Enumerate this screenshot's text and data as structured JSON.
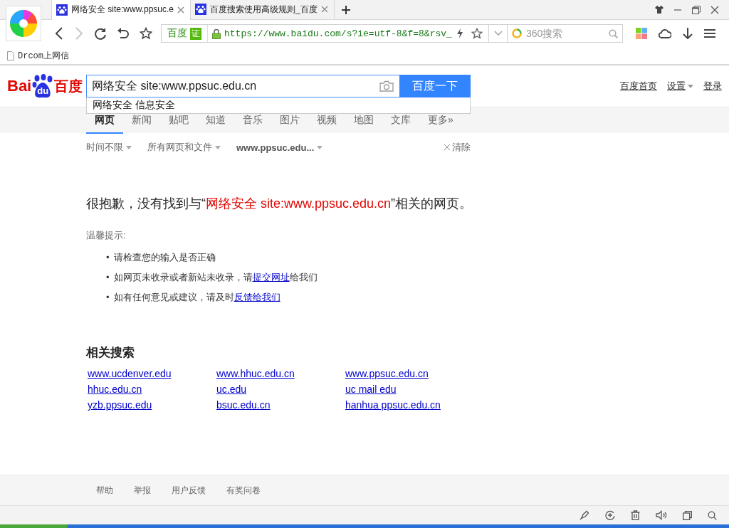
{
  "browser": {
    "tabs": [
      {
        "title": "网络安全 site:www.ppsuc.e",
        "selected": true
      },
      {
        "title": "百度搜索使用高级规则_百度",
        "selected": false
      }
    ],
    "toolbar": {
      "site_label": "百度",
      "cert_badge": "证",
      "url": "https://www.baidu.com/s?ie=utf-8&f=8&rsv_",
      "search_placeholder": "360搜索"
    },
    "bookmarks": [
      "Drcom上网信"
    ]
  },
  "page": {
    "logo": [
      "Bai",
      "du",
      "百度"
    ],
    "search_value": "网络安全 site:www.ppsuc.edu.cn",
    "search_button": "百度一下",
    "suggestion": "网络安全 信息安全",
    "top_links": [
      {
        "label": "百度首页",
        "dropdown": false
      },
      {
        "label": "设置",
        "dropdown": true
      },
      {
        "label": "登录",
        "dropdown": false
      }
    ],
    "nav_tabs": [
      {
        "label": "网页",
        "selected": true
      },
      {
        "label": "新闻",
        "selected": false
      },
      {
        "label": "贴吧",
        "selected": false
      },
      {
        "label": "知道",
        "selected": false
      },
      {
        "label": "音乐",
        "selected": false
      },
      {
        "label": "图片",
        "selected": false
      },
      {
        "label": "视频",
        "selected": false
      },
      {
        "label": "地图",
        "selected": false
      },
      {
        "label": "文库",
        "selected": false
      },
      {
        "label": "更多»",
        "selected": false
      }
    ],
    "filters": [
      {
        "label": "时间不限",
        "selected": false
      },
      {
        "label": "所有网页和文件",
        "selected": false
      },
      {
        "label": "www.ppsuc.edu...",
        "selected": true
      }
    ],
    "clear_label": "清除",
    "message": {
      "before": "很抱歉，没有找到与“",
      "query": "网络安全 site:www.ppsuc.edu.cn",
      "after": "”相关的网页。"
    },
    "tips_title": "温馨提示:",
    "tips": [
      {
        "marker": "•",
        "text": "请检查您的输入是否正确"
      },
      {
        "marker": "•",
        "text": "如网页未收录或者新站未收录，请",
        "link": "提交网址",
        "after": "给我们"
      },
      {
        "marker": "•",
        "text": "如有任何意见或建议，请及时",
        "link": "反馈给我们"
      }
    ],
    "related_title": "相关搜索",
    "related": [
      "www.ucdenver.edu",
      "www.hhuc.edu.cn",
      "www.ppsuc.edu.cn",
      "hhuc.edu.cn",
      "uc.edu",
      "uc mail edu",
      "yzb.ppsuc.edu",
      "bsuc.edu.cn",
      "hanhua ppsuc.edu.cn"
    ],
    "footer_links": [
      "帮助",
      "举报",
      "用户反馈",
      "有奖问卷"
    ]
  }
}
